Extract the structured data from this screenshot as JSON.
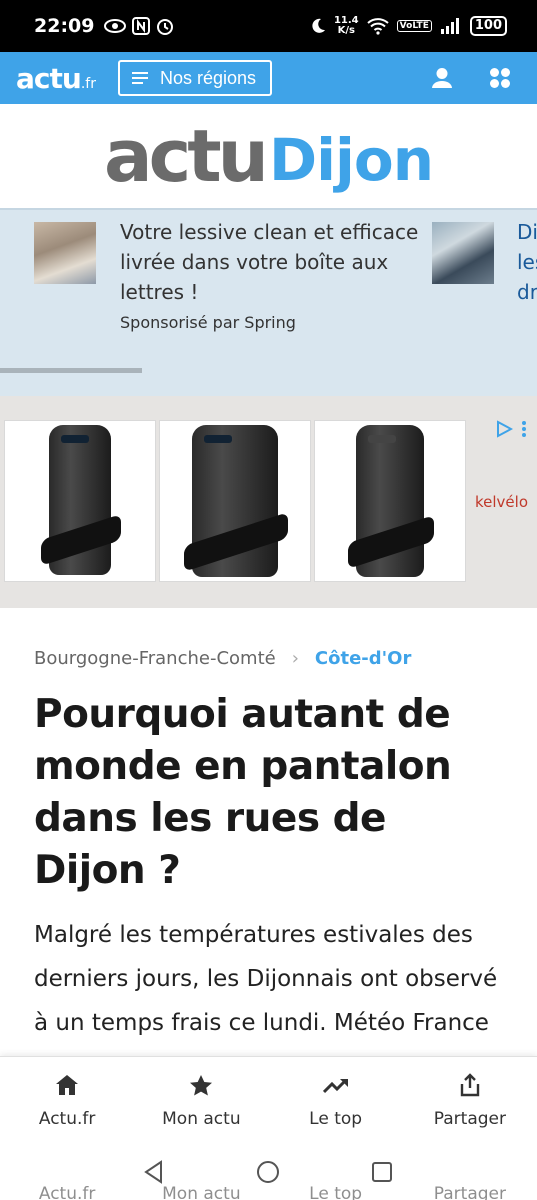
{
  "status_bar": {
    "time": "22:09",
    "net_speed_value": "11.4",
    "net_speed_unit": "K/s",
    "volte": "VoLTE",
    "battery": "100"
  },
  "topbar": {
    "brand": "actu",
    "brand_suffix": ".fr",
    "regions_label": "Nos régions",
    "accent_color": "#3fa3e8"
  },
  "site_logo": {
    "part1": "actu",
    "part2": "Dijon"
  },
  "sponsored": {
    "text": "Votre lessive clean et efficace livrée dans votre boîte aux lettres !",
    "sponsor": "Sponsorisé par Spring",
    "next_text": "Di les dr"
  },
  "ad": {
    "advertiser": "kelvélo",
    "products": [
      "battery-pack-1",
      "battery-pack-2",
      "battery-pack-3"
    ]
  },
  "article": {
    "breadcrumb_parent": "Bourgogne-Franche-Comté",
    "breadcrumb_current": "Côte-d'Or",
    "headline": "Pourquoi autant de monde en pantalon dans les rues de Dijon ?",
    "lead": "Malgré les températures estivales des derniers jours, les Dijonnais ont observé à un temps frais ce lundi. Météo France annonce une hausse"
  },
  "bottom_nav": {
    "items": [
      {
        "label": "Actu.fr",
        "icon": "home-icon"
      },
      {
        "label": "Mon actu",
        "icon": "star-icon"
      },
      {
        "label": "Le top",
        "icon": "trending-icon"
      },
      {
        "label": "Partager",
        "icon": "share-icon"
      }
    ]
  },
  "system_nav": {
    "ghost_labels": [
      "Actu.fr",
      "Mon actu",
      "Le top",
      "Partager"
    ]
  }
}
